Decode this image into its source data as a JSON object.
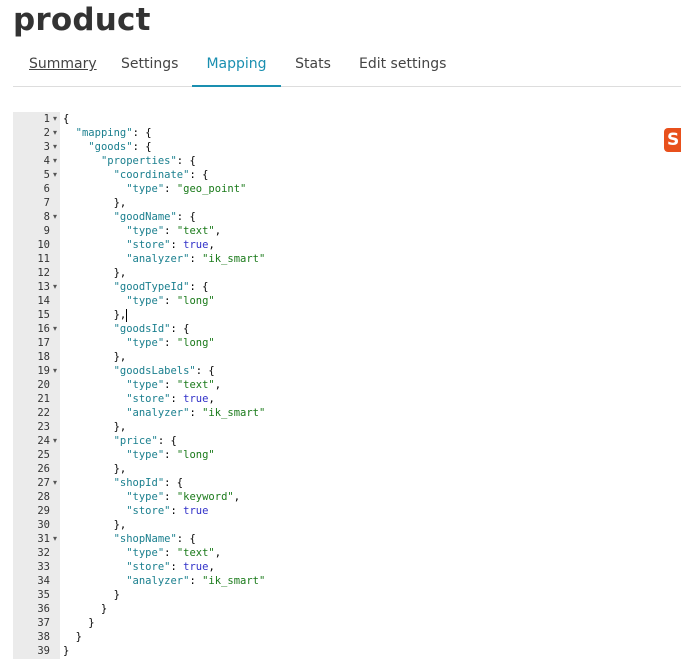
{
  "page": {
    "title": "product"
  },
  "tabs": [
    {
      "label": "Summary"
    },
    {
      "label": "Settings"
    },
    {
      "label": "Mapping"
    },
    {
      "label": "Stats"
    },
    {
      "label": "Edit settings"
    }
  ],
  "active_tab": "Mapping",
  "logo": {
    "text": "S",
    "color": "#e8501c"
  },
  "colors": {
    "key": "#1a7f8e",
    "string": "#1a7a1a",
    "boolean": "#3030c8",
    "accent": "#1a8fb0"
  },
  "editor": {
    "fold_marker": "▾",
    "lines": [
      {
        "n": "1",
        "fold": true,
        "parts": [
          [
            "p",
            "{"
          ]
        ]
      },
      {
        "n": "2",
        "fold": true,
        "parts": [
          [
            "p",
            "  "
          ],
          [
            "k",
            "\"mapping\""
          ],
          [
            "p",
            ": {"
          ]
        ]
      },
      {
        "n": "3",
        "fold": true,
        "parts": [
          [
            "p",
            "    "
          ],
          [
            "k",
            "\"goods\""
          ],
          [
            "p",
            ": {"
          ]
        ]
      },
      {
        "n": "4",
        "fold": true,
        "parts": [
          [
            "p",
            "      "
          ],
          [
            "k",
            "\"properties\""
          ],
          [
            "p",
            ": {"
          ]
        ]
      },
      {
        "n": "5",
        "fold": true,
        "parts": [
          [
            "p",
            "        "
          ],
          [
            "k",
            "\"coordinate\""
          ],
          [
            "p",
            ": {"
          ]
        ]
      },
      {
        "n": "6",
        "fold": false,
        "parts": [
          [
            "p",
            "          "
          ],
          [
            "k",
            "\"type\""
          ],
          [
            "p",
            ": "
          ],
          [
            "s",
            "\"geo_point\""
          ]
        ]
      },
      {
        "n": "7",
        "fold": false,
        "parts": [
          [
            "p",
            "        },"
          ]
        ]
      },
      {
        "n": "8",
        "fold": true,
        "parts": [
          [
            "p",
            "        "
          ],
          [
            "k",
            "\"goodName\""
          ],
          [
            "p",
            ": {"
          ]
        ]
      },
      {
        "n": "9",
        "fold": false,
        "parts": [
          [
            "p",
            "          "
          ],
          [
            "k",
            "\"type\""
          ],
          [
            "p",
            ": "
          ],
          [
            "s",
            "\"text\""
          ],
          [
            "p",
            ","
          ]
        ]
      },
      {
        "n": "10",
        "fold": false,
        "parts": [
          [
            "p",
            "          "
          ],
          [
            "k",
            "\"store\""
          ],
          [
            "p",
            ": "
          ],
          [
            "b",
            "true"
          ],
          [
            "p",
            ","
          ]
        ]
      },
      {
        "n": "11",
        "fold": false,
        "parts": [
          [
            "p",
            "          "
          ],
          [
            "k",
            "\"analyzer\""
          ],
          [
            "p",
            ": "
          ],
          [
            "s",
            "\"ik_smart\""
          ]
        ]
      },
      {
        "n": "12",
        "fold": false,
        "parts": [
          [
            "p",
            "        },"
          ]
        ]
      },
      {
        "n": "13",
        "fold": true,
        "parts": [
          [
            "p",
            "        "
          ],
          [
            "k",
            "\"goodTypeId\""
          ],
          [
            "p",
            ": {"
          ]
        ]
      },
      {
        "n": "14",
        "fold": false,
        "parts": [
          [
            "p",
            "          "
          ],
          [
            "k",
            "\"type\""
          ],
          [
            "p",
            ": "
          ],
          [
            "s",
            "\"long\""
          ]
        ]
      },
      {
        "n": "15",
        "fold": false,
        "cursor": true,
        "parts": [
          [
            "p",
            "        },"
          ]
        ]
      },
      {
        "n": "16",
        "fold": true,
        "parts": [
          [
            "p",
            "        "
          ],
          [
            "k",
            "\"goodsId\""
          ],
          [
            "p",
            ": {"
          ]
        ]
      },
      {
        "n": "17",
        "fold": false,
        "parts": [
          [
            "p",
            "          "
          ],
          [
            "k",
            "\"type\""
          ],
          [
            "p",
            ": "
          ],
          [
            "s",
            "\"long\""
          ]
        ]
      },
      {
        "n": "18",
        "fold": false,
        "parts": [
          [
            "p",
            "        },"
          ]
        ]
      },
      {
        "n": "19",
        "fold": true,
        "parts": [
          [
            "p",
            "        "
          ],
          [
            "k",
            "\"goodsLabels\""
          ],
          [
            "p",
            ": {"
          ]
        ]
      },
      {
        "n": "20",
        "fold": false,
        "parts": [
          [
            "p",
            "          "
          ],
          [
            "k",
            "\"type\""
          ],
          [
            "p",
            ": "
          ],
          [
            "s",
            "\"text\""
          ],
          [
            "p",
            ","
          ]
        ]
      },
      {
        "n": "21",
        "fold": false,
        "parts": [
          [
            "p",
            "          "
          ],
          [
            "k",
            "\"store\""
          ],
          [
            "p",
            ": "
          ],
          [
            "b",
            "true"
          ],
          [
            "p",
            ","
          ]
        ]
      },
      {
        "n": "22",
        "fold": false,
        "parts": [
          [
            "p",
            "          "
          ],
          [
            "k",
            "\"analyzer\""
          ],
          [
            "p",
            ": "
          ],
          [
            "s",
            "\"ik_smart\""
          ]
        ]
      },
      {
        "n": "23",
        "fold": false,
        "parts": [
          [
            "p",
            "        },"
          ]
        ]
      },
      {
        "n": "24",
        "fold": true,
        "parts": [
          [
            "p",
            "        "
          ],
          [
            "k",
            "\"price\""
          ],
          [
            "p",
            ": {"
          ]
        ]
      },
      {
        "n": "25",
        "fold": false,
        "parts": [
          [
            "p",
            "          "
          ],
          [
            "k",
            "\"type\""
          ],
          [
            "p",
            ": "
          ],
          [
            "s",
            "\"long\""
          ]
        ]
      },
      {
        "n": "26",
        "fold": false,
        "parts": [
          [
            "p",
            "        },"
          ]
        ]
      },
      {
        "n": "27",
        "fold": true,
        "parts": [
          [
            "p",
            "        "
          ],
          [
            "k",
            "\"shopId\""
          ],
          [
            "p",
            ": {"
          ]
        ]
      },
      {
        "n": "28",
        "fold": false,
        "parts": [
          [
            "p",
            "          "
          ],
          [
            "k",
            "\"type\""
          ],
          [
            "p",
            ": "
          ],
          [
            "s",
            "\"keyword\""
          ],
          [
            "p",
            ","
          ]
        ]
      },
      {
        "n": "29",
        "fold": false,
        "parts": [
          [
            "p",
            "          "
          ],
          [
            "k",
            "\"store\""
          ],
          [
            "p",
            ": "
          ],
          [
            "b",
            "true"
          ]
        ]
      },
      {
        "n": "30",
        "fold": false,
        "parts": [
          [
            "p",
            "        },"
          ]
        ]
      },
      {
        "n": "31",
        "fold": true,
        "parts": [
          [
            "p",
            "        "
          ],
          [
            "k",
            "\"shopName\""
          ],
          [
            "p",
            ": {"
          ]
        ]
      },
      {
        "n": "32",
        "fold": false,
        "parts": [
          [
            "p",
            "          "
          ],
          [
            "k",
            "\"type\""
          ],
          [
            "p",
            ": "
          ],
          [
            "s",
            "\"text\""
          ],
          [
            "p",
            ","
          ]
        ]
      },
      {
        "n": "33",
        "fold": false,
        "parts": [
          [
            "p",
            "          "
          ],
          [
            "k",
            "\"store\""
          ],
          [
            "p",
            ": "
          ],
          [
            "b",
            "true"
          ],
          [
            "p",
            ","
          ]
        ]
      },
      {
        "n": "34",
        "fold": false,
        "parts": [
          [
            "p",
            "          "
          ],
          [
            "k",
            "\"analyzer\""
          ],
          [
            "p",
            ": "
          ],
          [
            "s",
            "\"ik_smart\""
          ]
        ]
      },
      {
        "n": "35",
        "fold": false,
        "parts": [
          [
            "p",
            "        }"
          ]
        ]
      },
      {
        "n": "36",
        "fold": false,
        "parts": [
          [
            "p",
            "      }"
          ]
        ]
      },
      {
        "n": "37",
        "fold": false,
        "parts": [
          [
            "p",
            "    }"
          ]
        ]
      },
      {
        "n": "38",
        "fold": false,
        "parts": [
          [
            "p",
            "  }"
          ]
        ]
      },
      {
        "n": "39",
        "fold": false,
        "parts": [
          [
            "p",
            "}"
          ]
        ]
      }
    ]
  }
}
